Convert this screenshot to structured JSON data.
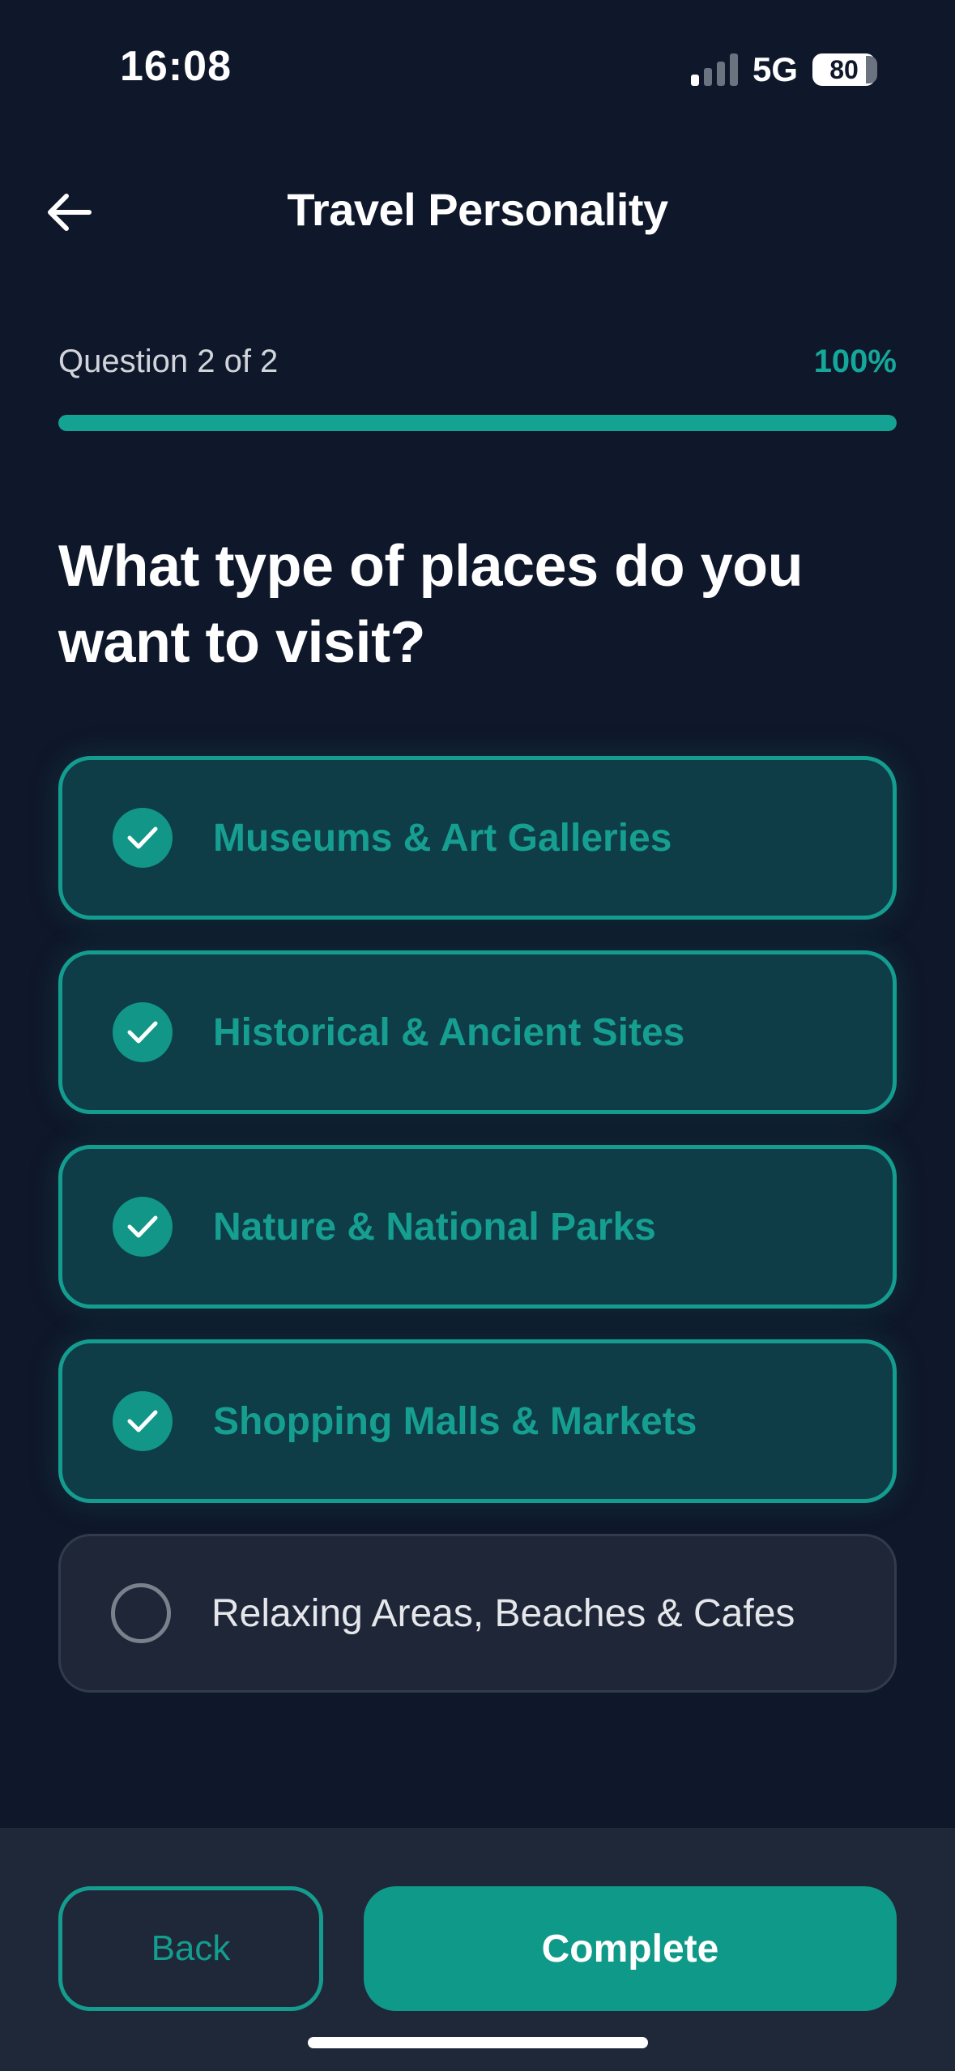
{
  "status_bar": {
    "time": "16:08",
    "network": "5G",
    "battery": "80",
    "signal_bars_active": 1,
    "signal_bars_total": 4
  },
  "header": {
    "title": "Travel Personality",
    "back_icon": "arrow-left-icon"
  },
  "progress": {
    "label": "Question 2 of 2",
    "percent_text": "100%",
    "fraction": 1.0
  },
  "question": "What type of places do you want to visit?",
  "options": [
    {
      "label": "Museums & Art Galleries",
      "selected": true
    },
    {
      "label": "Historical & Ancient Sites",
      "selected": true
    },
    {
      "label": "Nature & National Parks",
      "selected": true
    },
    {
      "label": "Shopping Malls & Markets",
      "selected": true
    },
    {
      "label": "Relaxing Areas, Beaches & Cafes",
      "selected": false
    }
  ],
  "footer": {
    "back_label": "Back",
    "complete_label": "Complete"
  },
  "colors": {
    "background": "#0f172a",
    "accent": "#14a392",
    "selected_card": "#0e3c47",
    "footer": "#1f2839"
  }
}
